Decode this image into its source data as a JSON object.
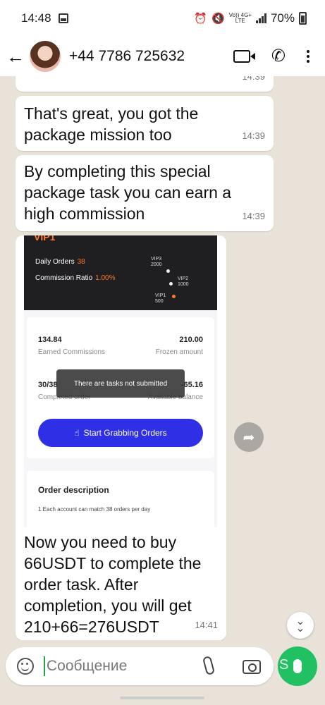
{
  "status_bar": {
    "time": "14:48",
    "network_top": "Vo)) 4G+",
    "network_bottom": "LTE",
    "battery": "70%"
  },
  "header": {
    "contact": "+44 7786 725632",
    "icons": [
      "back-arrow-icon",
      "video-call-icon",
      "phone-icon",
      "more-options-icon"
    ]
  },
  "messages": [
    {
      "text": "screenshot",
      "time": "14:39"
    },
    {
      "text": "That's great, you got the package mission too",
      "time": "14:39"
    },
    {
      "text": "By completing this special package task you can earn a high commission",
      "time": "14:39"
    },
    {
      "text": "Now you need to buy 66USDT to complete the order task. After completion, you will get 210+66=276USDT",
      "time": "14:41"
    }
  ],
  "screenshot": {
    "logo": "VIP1",
    "daily_orders_label": "Daily Orders",
    "daily_orders_value": "38",
    "commission_ratio_label": "Commission Ratio",
    "commission_ratio_value": "1.00%",
    "tiers": [
      {
        "name": "VIP3",
        "value": "2000"
      },
      {
        "name": "VIP2",
        "value": "1000"
      },
      {
        "name": "VIP1",
        "value": "500"
      }
    ],
    "earned_value": "134.84",
    "earned_label": "Earned Commissions",
    "frozen_value": "210.00",
    "frozen_label": "Frozen amount",
    "completed_value": "30/38",
    "completed_label": "Completed order",
    "balance_value": "-65.16",
    "balance_label": "Available balance",
    "toast": "There are tasks not submitted",
    "button": "Start Grabbing Orders",
    "order_title": "Order description",
    "order_line": "1.Each account can match 38 orders per day"
  },
  "composer": {
    "placeholder": "Сообщение",
    "mic_letter": "S"
  },
  "colors": {
    "accent_green": "#21c063",
    "vip_orange": "#ff7a2a",
    "button_blue": "#2f2fe6"
  }
}
